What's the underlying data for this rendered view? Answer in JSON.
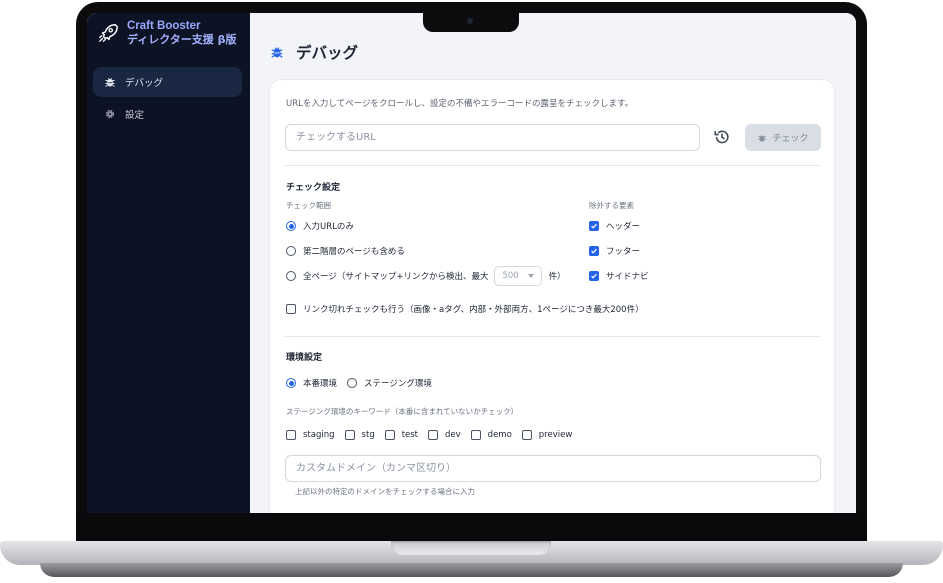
{
  "brand": {
    "name": "Craft Booster",
    "subtitle": "ディレクター支援 β版"
  },
  "sidebar": {
    "items": [
      {
        "label": "デバッグ",
        "icon": "bug-icon",
        "active": true
      },
      {
        "label": "設定",
        "icon": "gear-icon",
        "active": false
      }
    ]
  },
  "page": {
    "title": "デバッグ",
    "description": "URLを入力してページをクロールし、設定の不備やエラーコードの露呈をチェックします。",
    "url_placeholder": "チェックするURL",
    "check_button": "チェック"
  },
  "check_settings": {
    "title": "チェック設定",
    "scope_label": "チェック範囲",
    "scope_options": [
      {
        "label": "入力URLのみ",
        "selected": true
      },
      {
        "label": "第二階層のページも含める",
        "selected": false
      },
      {
        "label_prefix": "全ページ（サイトマップ+リンクから検出、最大",
        "max_value": "500",
        "label_suffix": "件）",
        "selected": false
      }
    ],
    "exclude_label": "除外する要素",
    "exclude_options": [
      {
        "label": "ヘッダー",
        "checked": true
      },
      {
        "label": "フッター",
        "checked": true
      },
      {
        "label": "サイドナビ",
        "checked": true
      }
    ],
    "link_check": {
      "label": "リンク切れチェックも行う（画像・aタグ、内部・外部両方、1ページにつき最大200件）",
      "checked": false
    }
  },
  "env_settings": {
    "title": "環境設定",
    "options": [
      {
        "label": "本番環境",
        "selected": true
      },
      {
        "label": "ステージング環境",
        "selected": false
      }
    ],
    "keywords_label": "ステージング環境のキーワード（本番に含まれていないかチェック）",
    "keywords": [
      "staging",
      "stg",
      "test",
      "dev",
      "demo",
      "preview"
    ],
    "domain_placeholder": "カスタムドメイン（カンマ区切り）",
    "domain_hint": "上記以外の特定のドメインをチェックする場合に入力"
  },
  "colors": {
    "sidebar_bg": "#0b1324",
    "accent": "#2563eb",
    "brand": "#9ba7ff"
  }
}
